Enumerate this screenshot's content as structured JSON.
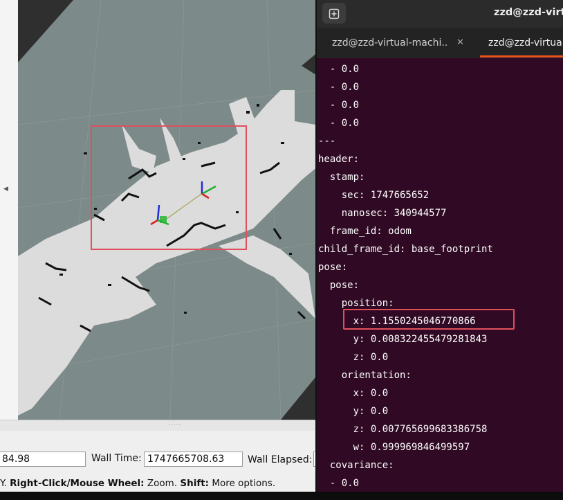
{
  "rviz": {
    "time_bar": {
      "ros_time_value": "84.98",
      "wall_time_label": "Wall Time:",
      "wall_time_value": "1747665708.63",
      "wall_elapsed_label": "Wall Elapsed:"
    },
    "hint": {
      "prefix": "Y. ",
      "right_click_label": "Right-Click/Mouse Wheel:",
      "right_click_desc": " Zoom. ",
      "shift_label": "Shift:",
      "shift_desc": " More options."
    },
    "highlight_color": "#e0505c"
  },
  "terminal": {
    "window_title": "zzd@zzd-virtual-",
    "newtab_icon": "new-tab-icon",
    "tabs": [
      {
        "label": "zzd@zzd-virtual-machi...",
        "active": false
      },
      {
        "label": "zzd@zzd-virtual-",
        "active": true
      }
    ],
    "lines": [
      "  - 0.0",
      "  - 0.0",
      "  - 0.0",
      "  - 0.0",
      "---",
      "header:",
      "  stamp:",
      "    sec: 1747665652",
      "    nanosec: 340944577",
      "  frame_id: odom",
      "child_frame_id: base_footprint",
      "pose:",
      "  pose:",
      "    position:",
      "      x: 1.1550245046770866",
      "      y: 0.008322455479281843",
      "      z: 0.0",
      "    orientation:",
      "      x: 0.0",
      "      y: 0.0",
      "      z: 0.007765699683386758",
      "      w: 0.999969846499597",
      "  covariance:",
      "  - 0.0"
    ],
    "highlighted_line": 14,
    "background": "#300a24",
    "accent": "#e95420"
  }
}
